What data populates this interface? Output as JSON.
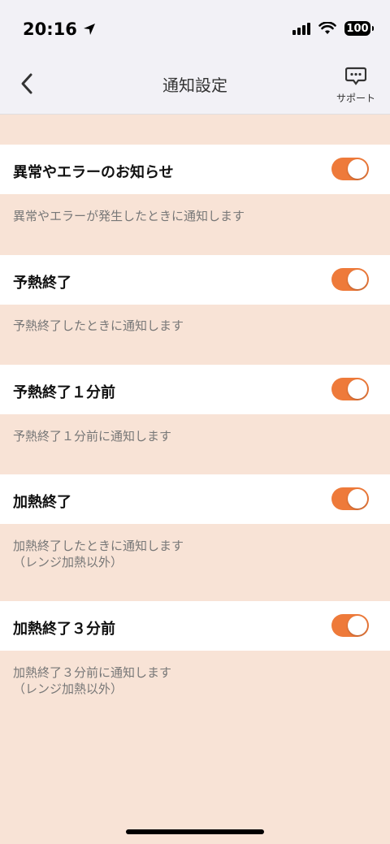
{
  "status_bar": {
    "time": "20:16",
    "battery": "100"
  },
  "nav": {
    "title": "通知設定",
    "support_label": "サポート"
  },
  "colors": {
    "accent": "#ee7a3a",
    "background": "#f8e3d6"
  },
  "settings": [
    {
      "label": "異常やエラーのお知らせ",
      "description": "異常やエラーが発生したときに通知します",
      "enabled": true
    },
    {
      "label": "予熱終了",
      "description": "予熱終了したときに通知します",
      "enabled": true
    },
    {
      "label": "予熱終了１分前",
      "description": "予熱終了１分前に通知します",
      "enabled": true
    },
    {
      "label": "加熱終了",
      "description": "加熱終了したときに通知します\n（レンジ加熱以外）",
      "enabled": true
    },
    {
      "label": "加熱終了３分前",
      "description": "加熱終了３分前に通知します\n（レンジ加熱以外）",
      "enabled": true
    }
  ]
}
